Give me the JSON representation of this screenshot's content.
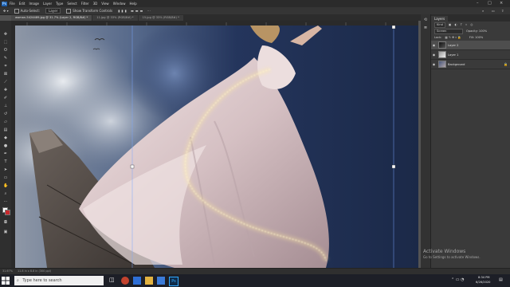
{
  "menu": {
    "logo": "Ps",
    "items": [
      "File",
      "Edit",
      "Image",
      "Layer",
      "Type",
      "Select",
      "Filter",
      "3D",
      "View",
      "Window",
      "Help"
    ]
  },
  "options": {
    "auto_select": "Auto-Select:",
    "auto_select_target": "Layer",
    "show_transform": "Show Transform Controls"
  },
  "tabs": [
    {
      "label": "woman-5424489.jpg @ 31.7% (Layer 2, RGB/8#) *",
      "active": true
    },
    {
      "label": "11.jpg @ 33% (RGB/8#) *",
      "active": false
    },
    {
      "label": "15.jpg @ 33% (RGB/8#) *",
      "active": false
    }
  ],
  "layers_panel": {
    "tab": "Layers",
    "kind": "Kind",
    "blend_mode": "Screen",
    "opacity": "Opacity: 100%",
    "lock": "Lock:",
    "fill": "Fill: 100%",
    "layers": [
      {
        "name": "Layer 2",
        "selected": true
      },
      {
        "name": "Layer 1",
        "selected": false
      },
      {
        "name": "Background",
        "selected": false
      }
    ]
  },
  "status": {
    "zoom": "31.67%",
    "doc": "11.8 in x 8.8 in (300 ppi)"
  },
  "watermark": {
    "title": "Activate Windows",
    "subtitle": "Go to Settings to activate Windows."
  },
  "taskbar": {
    "search_placeholder": "Type here to search",
    "time": "8:34 PM",
    "date": "6/26/2020"
  },
  "colors": {
    "sky_dark": "#1d2c4d",
    "dress": "#d9c6c8",
    "glow": "#ffe9a3",
    "background_swatch": "#c8282c"
  }
}
